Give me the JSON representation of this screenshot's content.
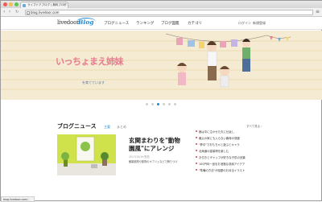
{
  "browser": {
    "tab_title": "ライブドアブログ | 無料ブログ",
    "url": "blog.livedoor.com",
    "status_text": "blog.livedoor.com/..."
  },
  "header": {
    "logo_text": "livedoor",
    "logo_blog": "Blog",
    "nav": [
      "ブログニュース",
      "ランキング",
      "ブログ図鑑",
      "カテゴリ"
    ],
    "login": "ログイン",
    "register": "新規登録"
  },
  "hero": {
    "title": "いっちょまえ姉妹",
    "subtitle": "を育てています",
    "slides": 6,
    "active_slide": 2
  },
  "news": {
    "title": "ブログニュース",
    "tabs": [
      "主要",
      "まとめ"
    ],
    "see_all": "すべて見る ›",
    "featured_title": "玄関まわりを\"動物園風\"にアレンジ",
    "featured_meta": "2017/10/19 配信",
    "featured_desc": "観葉植物や動物のオブジェなどで飾りつけ",
    "items": [
      "娘は中に泣かせた夫に仕返し",
      "義父の家にも入らない義母の態度",
      "\"夢中\"でおもちゃと遊ぶとキャラ",
      "北海道の猫事情を楽しむ",
      "お付きとギャップが好きな子供の言葉",
      "100円均一品をお洒落な収納アイデア",
      "\"準備の方法\"が話題のお弁当イラスト"
    ]
  },
  "colors": {
    "accent": "#1e88d4",
    "hero_bg": "#f4ebd2",
    "hero_title": "#e77a8e"
  }
}
